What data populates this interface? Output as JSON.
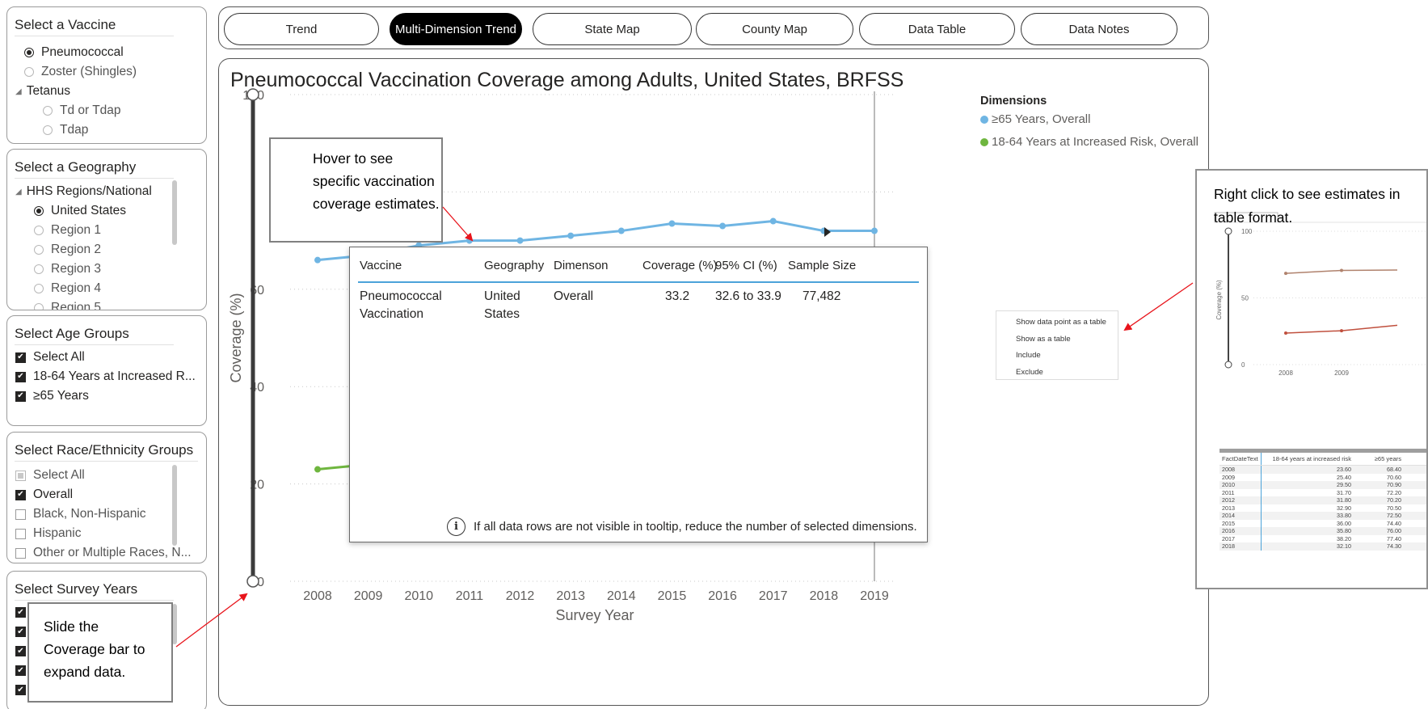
{
  "filters": {
    "vaccine": {
      "title": "Select a Vaccine",
      "options": [
        "Pneumococcal",
        "Zoster (Shingles)"
      ],
      "group": "Tetanus",
      "group_options": [
        "Td or Tdap",
        "Tdap"
      ]
    },
    "geography": {
      "title": "Select a Geography",
      "group": "HHS Regions/National",
      "options": [
        "United States",
        "Region 1",
        "Region 2",
        "Region 3",
        "Region 4",
        "Region 5"
      ]
    },
    "age": {
      "title": "Select Age Groups",
      "options": [
        "Select All",
        "18-64 Years at Increased R...",
        "≥65 Years"
      ]
    },
    "race": {
      "title": "Select Race/Ethnicity Groups",
      "options": [
        "Select All",
        "Overall",
        "Black, Non-Hispanic",
        "Hispanic",
        "Other or Multiple Races, N..."
      ]
    },
    "years": {
      "title": "Select Survey Years"
    }
  },
  "tabs": [
    "Trend",
    "Multi-Dimension Trend",
    "State Map",
    "County Map",
    "Data Table",
    "Data Notes"
  ],
  "active_tab": "Multi-Dimension Trend",
  "chart_data": {
    "type": "line",
    "title": "Pneumococcal Vaccination Coverage among Adults, United States, BRFSS",
    "xlabel": "Survey Year",
    "ylabel": "Coverage (%)",
    "ylim": [
      0,
      100
    ],
    "yticks": [
      0,
      20,
      40,
      60,
      100
    ],
    "categories": [
      "2008",
      "2009",
      "2010",
      "2011",
      "2012",
      "2013",
      "2014",
      "2015",
      "2016",
      "2017",
      "2018",
      "2019"
    ],
    "legend_title": "Dimensions",
    "legend_position": "right",
    "series": [
      {
        "name": "≥65 Years, Overall",
        "color": "#6fb5e3",
        "values": [
          66.0,
          67.0,
          69.0,
          70.0,
          70.0,
          71.0,
          72.0,
          73.5,
          73.0,
          74.0,
          72.0,
          72.0
        ]
      },
      {
        "name": "18-64 Years at Increased Risk, Overall",
        "color": "#6fb63f",
        "values": [
          23.0,
          24.0,
          26.0,
          27.0,
          27.5,
          28.5,
          29.5,
          30.5,
          31.0,
          31.5,
          32.0,
          33.2
        ]
      }
    ]
  },
  "tooltip": {
    "headers": [
      "Vaccine",
      "Geography",
      "Dimenson",
      "Coverage (%)",
      "95% CI (%)",
      "Sample Size"
    ],
    "row": [
      "Pneumococcal Vaccination",
      "United States",
      "Overall",
      "33.2",
      "32.6 to 33.9",
      "77,482"
    ],
    "note": "If all data rows are not visible in tooltip, reduce the number of selected dimensions."
  },
  "context_menu": [
    "Show data point as a table",
    "Show as a table",
    "Include",
    "Exclude"
  ],
  "callouts": {
    "hover": "Hover to see specific vaccination coverage estimates.",
    "slide": "Slide the Coverage bar to expand data.",
    "right_click": "Right click to see estimates in table format."
  },
  "inset": {
    "yaxis_label": "Coverage (%)",
    "yticks": [
      "100",
      "50",
      "0"
    ],
    "xticks": [
      "2008",
      "2009"
    ],
    "table_headers": [
      "FactDateText",
      "18-64 years at increased risk",
      "≥65 years"
    ],
    "table_rows": [
      [
        "2008",
        "23.60",
        "68.40"
      ],
      [
        "2009",
        "25.40",
        "70.60"
      ],
      [
        "2010",
        "29.50",
        "70.90"
      ],
      [
        "2011",
        "31.70",
        "72.20"
      ],
      [
        "2012",
        "31.80",
        "70.20"
      ],
      [
        "2013",
        "32.90",
        "70.50"
      ],
      [
        "2014",
        "33.80",
        "72.50"
      ],
      [
        "2015",
        "36.00",
        "74.40"
      ],
      [
        "2016",
        "35.80",
        "76.00"
      ],
      [
        "2017",
        "38.20",
        "77.40"
      ],
      [
        "2018",
        "32.10",
        "74.30"
      ]
    ]
  }
}
